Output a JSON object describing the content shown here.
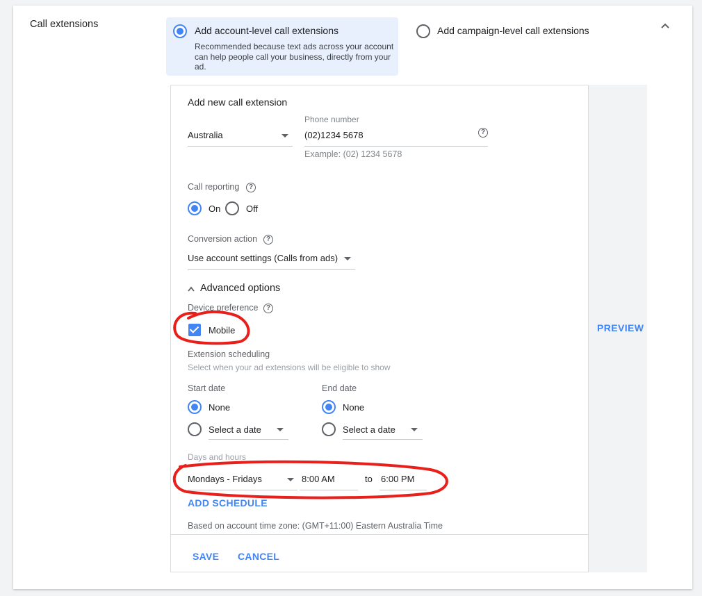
{
  "section": {
    "title": "Call extensions"
  },
  "extension_level": {
    "account": {
      "label": "Add account-level call extensions",
      "description": "Recommended because text ads across your account can help people call your business, directly from your ad.",
      "selected": true
    },
    "campaign": {
      "label": "Add campaign-level call extensions",
      "selected": false
    }
  },
  "form": {
    "heading": "Add new call extension",
    "country": "Australia",
    "phone": {
      "label": "Phone number",
      "value": "(02)1234 5678",
      "example": "Example: (02) 1234 5678"
    },
    "call_reporting": {
      "label": "Call reporting",
      "on": "On",
      "off": "Off",
      "selected": "On"
    },
    "conversion_action": {
      "label": "Conversion action",
      "value": "Use account settings (Calls from ads)"
    },
    "advanced": {
      "label": "Advanced options",
      "device_preference": {
        "label": "Device preference",
        "mobile_label": "Mobile",
        "checked": true
      },
      "scheduling": {
        "label": "Extension scheduling",
        "hint": "Select when your ad extensions will be eligible to show",
        "start_date": {
          "label": "Start date",
          "none": "None",
          "select": "Select a date",
          "selected": "None"
        },
        "end_date": {
          "label": "End date",
          "none": "None",
          "select": "Select a date",
          "selected": "None"
        },
        "days_hours": {
          "label": "Days and hours",
          "days": "Mondays - Fridays",
          "from": "8:00 AM",
          "to_label": "to",
          "to": "6:00 PM"
        },
        "add_schedule": "ADD SCHEDULE",
        "timezone": "Based on account time zone: (GMT+11:00) Eastern Australia Time"
      }
    },
    "actions": {
      "save": "SAVE",
      "cancel": "CANCEL"
    }
  },
  "preview": {
    "label": "PREVIEW"
  },
  "colors": {
    "accent": "#4285f4",
    "annotation": "#e8201b",
    "selected_bg": "#e8f0fe"
  }
}
